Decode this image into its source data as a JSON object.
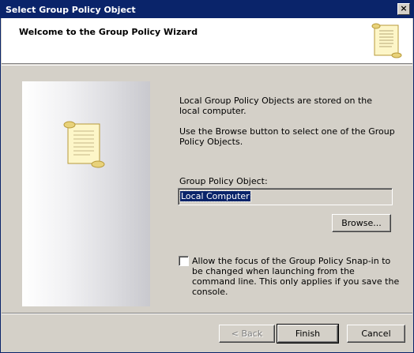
{
  "window": {
    "title": "Select Group Policy Object",
    "close_label": "×"
  },
  "header": {
    "title": "Welcome to the Group Policy Wizard",
    "icon": "scroll-icon"
  },
  "body": {
    "intro_text_1": "Local Group Policy Objects are stored on the local computer.",
    "intro_text_2": "Use the Browse button to select one of the Group Policy Objects.",
    "gpo_label": "Group Policy Object:",
    "gpo_value": "Local Computer",
    "browse_label": "Browse...",
    "checkbox_label": "Allow the focus of the Group Policy Snap-in to be changed when launching from the command line.  This only applies if you save the console.",
    "checkbox_checked": false
  },
  "footer": {
    "back_label": "< Back",
    "finish_label": "Finish",
    "cancel_label": "Cancel"
  },
  "colors": {
    "titlebar": "#0a246a",
    "face": "#d4d0c8",
    "selection": "#0a246a"
  }
}
